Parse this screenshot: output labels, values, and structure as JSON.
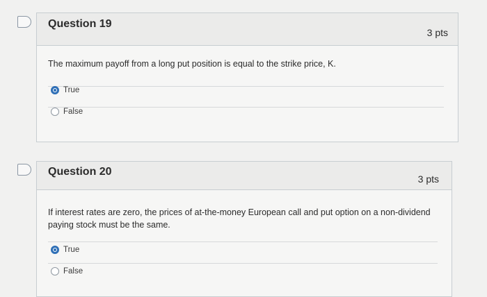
{
  "questions": [
    {
      "title": "Question 19",
      "points": "3 pts",
      "text": "The maximum payoff from a long put position is equal to the strike price, K.",
      "options": [
        {
          "label": "True",
          "selected": true
        },
        {
          "label": "False",
          "selected": false
        }
      ]
    },
    {
      "title": "Question 20",
      "points": "3 pts",
      "text": "If interest rates are zero, the prices of at-the-money European call and put option on a non-dividend paying stock must be the same.",
      "options": [
        {
          "label": "True",
          "selected": true
        },
        {
          "label": "False",
          "selected": false
        }
      ]
    }
  ],
  "colors": {
    "selected_radio": "#2f6fb6",
    "card_border": "#c7cdd1"
  }
}
